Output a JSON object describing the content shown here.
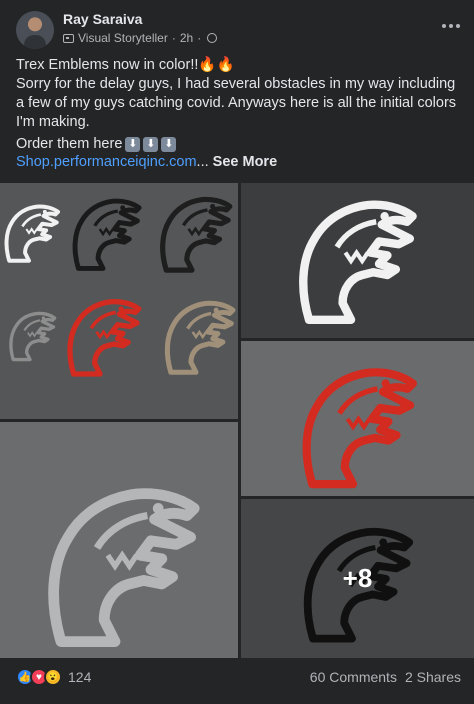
{
  "post": {
    "author": "Ray Saraiva",
    "badge": "Visual Storyteller",
    "time": "2h",
    "separator": "·",
    "text_line1": "Trex Emblems now in color!!",
    "fire_emojis": "🔥🔥",
    "text_body": "Sorry for the delay guys, I had several obstacles in my way including a few of my guys catching covid. Anyways here is all the initial colors I'm making.",
    "order_label": "Order them here",
    "order_arrows": [
      "⬇",
      "⬇",
      "⬇"
    ],
    "link": "Shop.performanceiqinc.com",
    "ellipsis": "...",
    "see_more": "See More"
  },
  "photos": {
    "more_count": "+8",
    "colors": {
      "white": "#f1f1f1",
      "black": "#1a1a1a",
      "red": "#d42b21",
      "gray": "#8d8d8d",
      "bronze": "#a0907a",
      "steel": "#b4b6b8"
    }
  },
  "footer": {
    "reaction_icons": [
      "like-icon",
      "love-icon",
      "wow-icon"
    ],
    "reaction_count": "124",
    "comments": "60 Comments",
    "shares": "2 Shares"
  }
}
